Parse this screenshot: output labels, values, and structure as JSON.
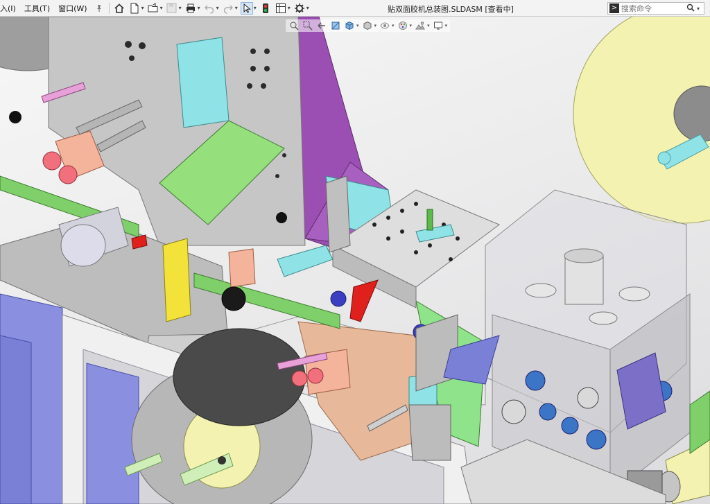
{
  "menubar": {
    "items": [
      {
        "label": "入(I)"
      },
      {
        "label": "工具(T)"
      },
      {
        "label": "窗口(W)"
      }
    ]
  },
  "toolbar": {
    "icons": [
      "pin-icon",
      "home-icon",
      "new-icon",
      "open-icon",
      "save-icon",
      "print-icon",
      "undo-icon",
      "redo-icon",
      "select-icon",
      "rebuild-icon",
      "file-properties-icon",
      "options-icon"
    ]
  },
  "window": {
    "title": "贴双面胶机总装图.SLDASM [查看中]"
  },
  "search": {
    "placeholder": "搜索命令"
  },
  "heads_up_toolbar": {
    "icons": [
      "zoom-to-fit-icon",
      "zoom-area-icon",
      "previous-view-icon",
      "section-view-icon",
      "view-orientation-icon",
      "display-style-icon",
      "hide-show-icon",
      "edit-appearance-icon",
      "apply-scene-icon",
      "view-settings-icon"
    ]
  },
  "colors": {
    "toolbar_bg": "#f3f3f3",
    "machine_frame": "#c8c8c8",
    "guard_glass": "#dcdcdc",
    "accent_purple": "#9b4fb3",
    "accent_green": "#7fd06a",
    "accent_cyan": "#8fe3e6",
    "roll_yellow": "#f3f2b0",
    "panel_blue": "#8a8fe0"
  }
}
